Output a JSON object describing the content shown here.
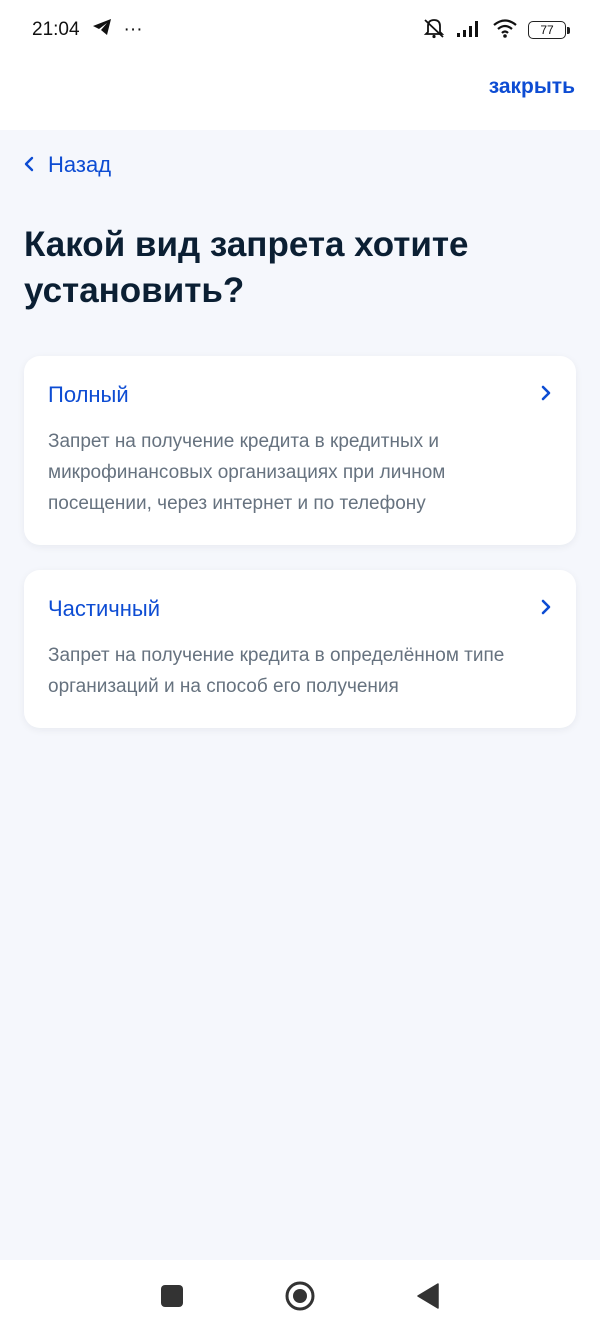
{
  "status_bar": {
    "time": "21:04",
    "more_indicator": "···",
    "battery": "77",
    "icons": [
      "telegram-icon",
      "mute-icon",
      "signal-icon",
      "wifi-icon",
      "battery-icon"
    ]
  },
  "header": {
    "close_label": "закрыть"
  },
  "back": {
    "label": "Назад"
  },
  "title": "Какой вид запрета хотите установить?",
  "options": [
    {
      "title": "Полный",
      "description": "Запрет на получение кредита в кредитных и микрофинансовых организациях при личном посещении, через интернет и по телефону"
    },
    {
      "title": "Частичный",
      "description": "Запрет на получение кредита в определённом типе организаций и на способ его получения"
    }
  ],
  "nav_bar": {
    "icons": [
      "recents-square-icon",
      "home-circle-icon",
      "back-triangle-icon"
    ]
  },
  "colors": {
    "accent": "#0d4cd3",
    "background": "#f5f7fc",
    "title_text": "#0b1f33",
    "secondary_text": "#66727f"
  }
}
